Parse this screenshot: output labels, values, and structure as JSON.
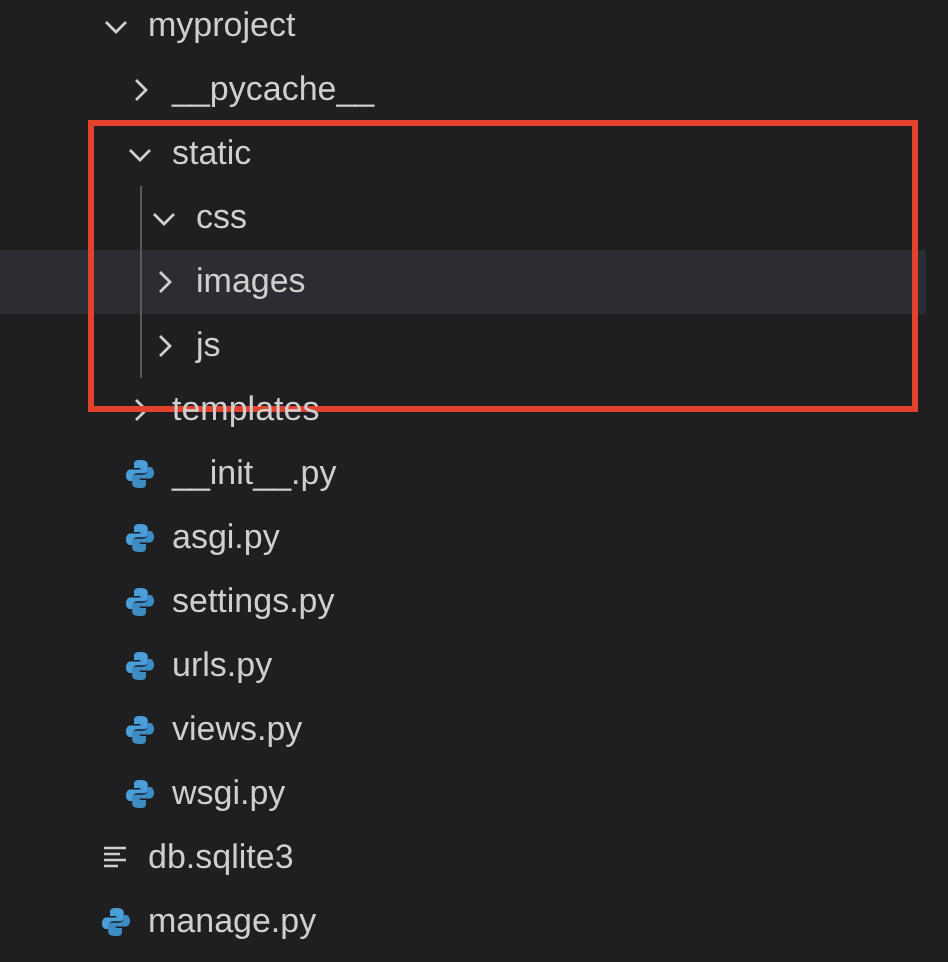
{
  "explorer": {
    "tree": [
      {
        "name": "myproject",
        "kind": "folder",
        "expanded": true,
        "highlighted": false,
        "children": [
          {
            "name": "__pycache__",
            "kind": "folder",
            "expanded": false,
            "highlighted": false
          },
          {
            "name": "static",
            "kind": "folder",
            "expanded": true,
            "highlighted": false,
            "children": [
              {
                "name": "css",
                "kind": "folder",
                "expanded": true,
                "highlighted": false
              },
              {
                "name": "images",
                "kind": "folder",
                "expanded": false,
                "highlighted": true
              },
              {
                "name": "js",
                "kind": "folder",
                "expanded": false,
                "highlighted": false
              }
            ]
          },
          {
            "name": "templates",
            "kind": "folder",
            "expanded": false,
            "highlighted": false
          },
          {
            "name": "__init__.py",
            "kind": "python",
            "highlighted": false
          },
          {
            "name": "asgi.py",
            "kind": "python",
            "highlighted": false
          },
          {
            "name": "settings.py",
            "kind": "python",
            "highlighted": false
          },
          {
            "name": "urls.py",
            "kind": "python",
            "highlighted": false
          },
          {
            "name": "views.py",
            "kind": "python",
            "highlighted": false
          },
          {
            "name": "wsgi.py",
            "kind": "python",
            "highlighted": false
          }
        ]
      },
      {
        "name": "db.sqlite3",
        "kind": "text",
        "highlighted": false
      },
      {
        "name": "manage.py",
        "kind": "python",
        "highlighted": false
      }
    ]
  }
}
